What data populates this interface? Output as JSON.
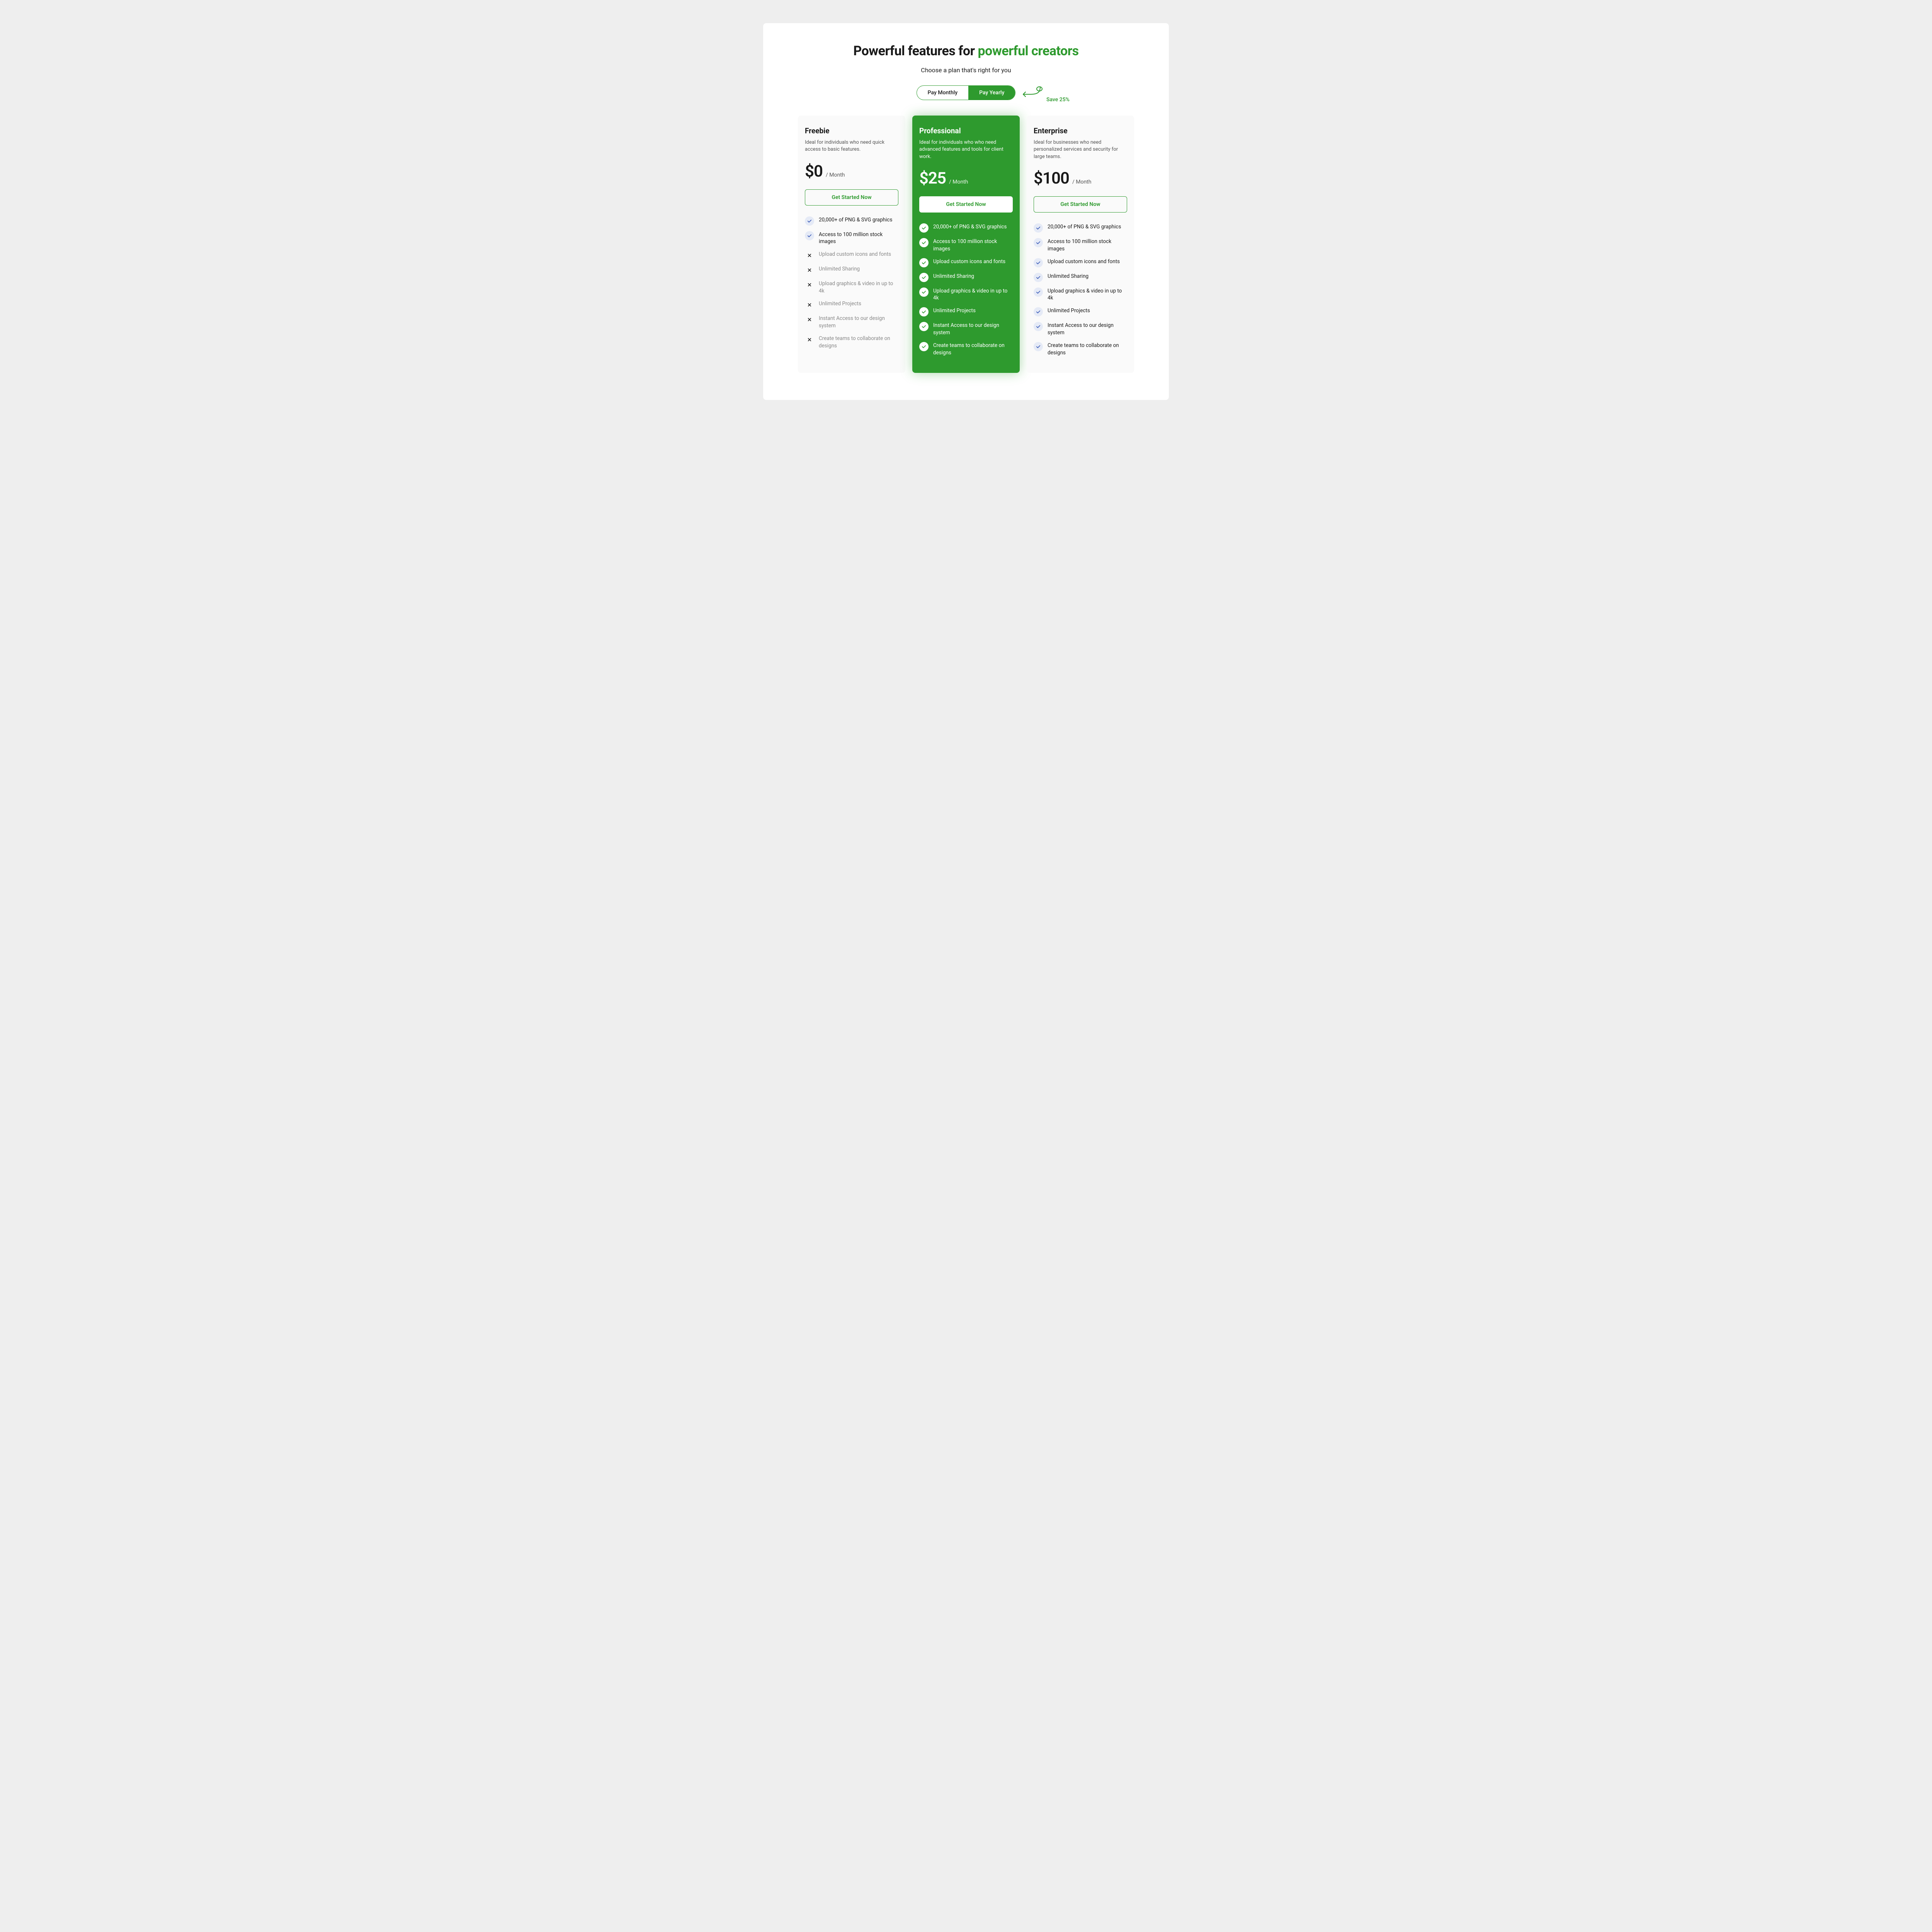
{
  "header": {
    "title_prefix": "Powerful features for ",
    "title_accent": "powerful creators",
    "subtitle": "Choose a plan that's right for you"
  },
  "toggle": {
    "monthly": "Pay Monthly",
    "yearly": "Pay Yearly",
    "save": "Save 25%"
  },
  "plans": [
    {
      "name": "Freebie",
      "desc": "Ideal for individuals who need quick access to basic features.",
      "price": "$0",
      "period": "/ Month",
      "cta": "Get Started Now",
      "featured": false,
      "features": [
        {
          "text": "20,000+ of PNG & SVG graphics",
          "included": true
        },
        {
          "text": "Access to 100 million stock images",
          "included": true
        },
        {
          "text": "Upload custom icons and fonts",
          "included": false
        },
        {
          "text": "Unlimited Sharing",
          "included": false
        },
        {
          "text": "Upload graphics & video in up to 4k",
          "included": false
        },
        {
          "text": "Unlimited Projects",
          "included": false
        },
        {
          "text": "Instant Access to our design system",
          "included": false
        },
        {
          "text": "Create teams to collaborate on designs",
          "included": false
        }
      ]
    },
    {
      "name": "Professional",
      "desc": "Ideal for individuals who who need advanced features and tools for client work.",
      "price": "$25",
      "period": "/ Month",
      "cta": "Get Started Now",
      "featured": true,
      "features": [
        {
          "text": "20,000+ of PNG & SVG graphics",
          "included": true
        },
        {
          "text": "Access to 100 million stock images",
          "included": true
        },
        {
          "text": "Upload custom icons and fonts",
          "included": true
        },
        {
          "text": "Unlimited Sharing",
          "included": true
        },
        {
          "text": "Upload graphics & video in up to 4k",
          "included": true
        },
        {
          "text": "Unlimited Projects",
          "included": true
        },
        {
          "text": "Instant Access to our design system",
          "included": true
        },
        {
          "text": "Create teams to collaborate on designs",
          "included": true
        }
      ]
    },
    {
      "name": "Enterprise",
      "desc": "Ideal for businesses who need personalized services and security for large teams.",
      "price": "$100",
      "period": "/ Month",
      "cta": "Get Started Now",
      "featured": false,
      "features": [
        {
          "text": "20,000+ of PNG & SVG graphics",
          "included": true
        },
        {
          "text": "Access to 100 million stock images",
          "included": true
        },
        {
          "text": "Upload custom icons and fonts",
          "included": true
        },
        {
          "text": "Unlimited Sharing",
          "included": true
        },
        {
          "text": "Upload graphics & video in up to 4k",
          "included": true
        },
        {
          "text": "Unlimited Projects",
          "included": true
        },
        {
          "text": "Instant Access to our design system",
          "included": true
        },
        {
          "text": "Create teams to collaborate on designs",
          "included": true
        }
      ]
    }
  ]
}
